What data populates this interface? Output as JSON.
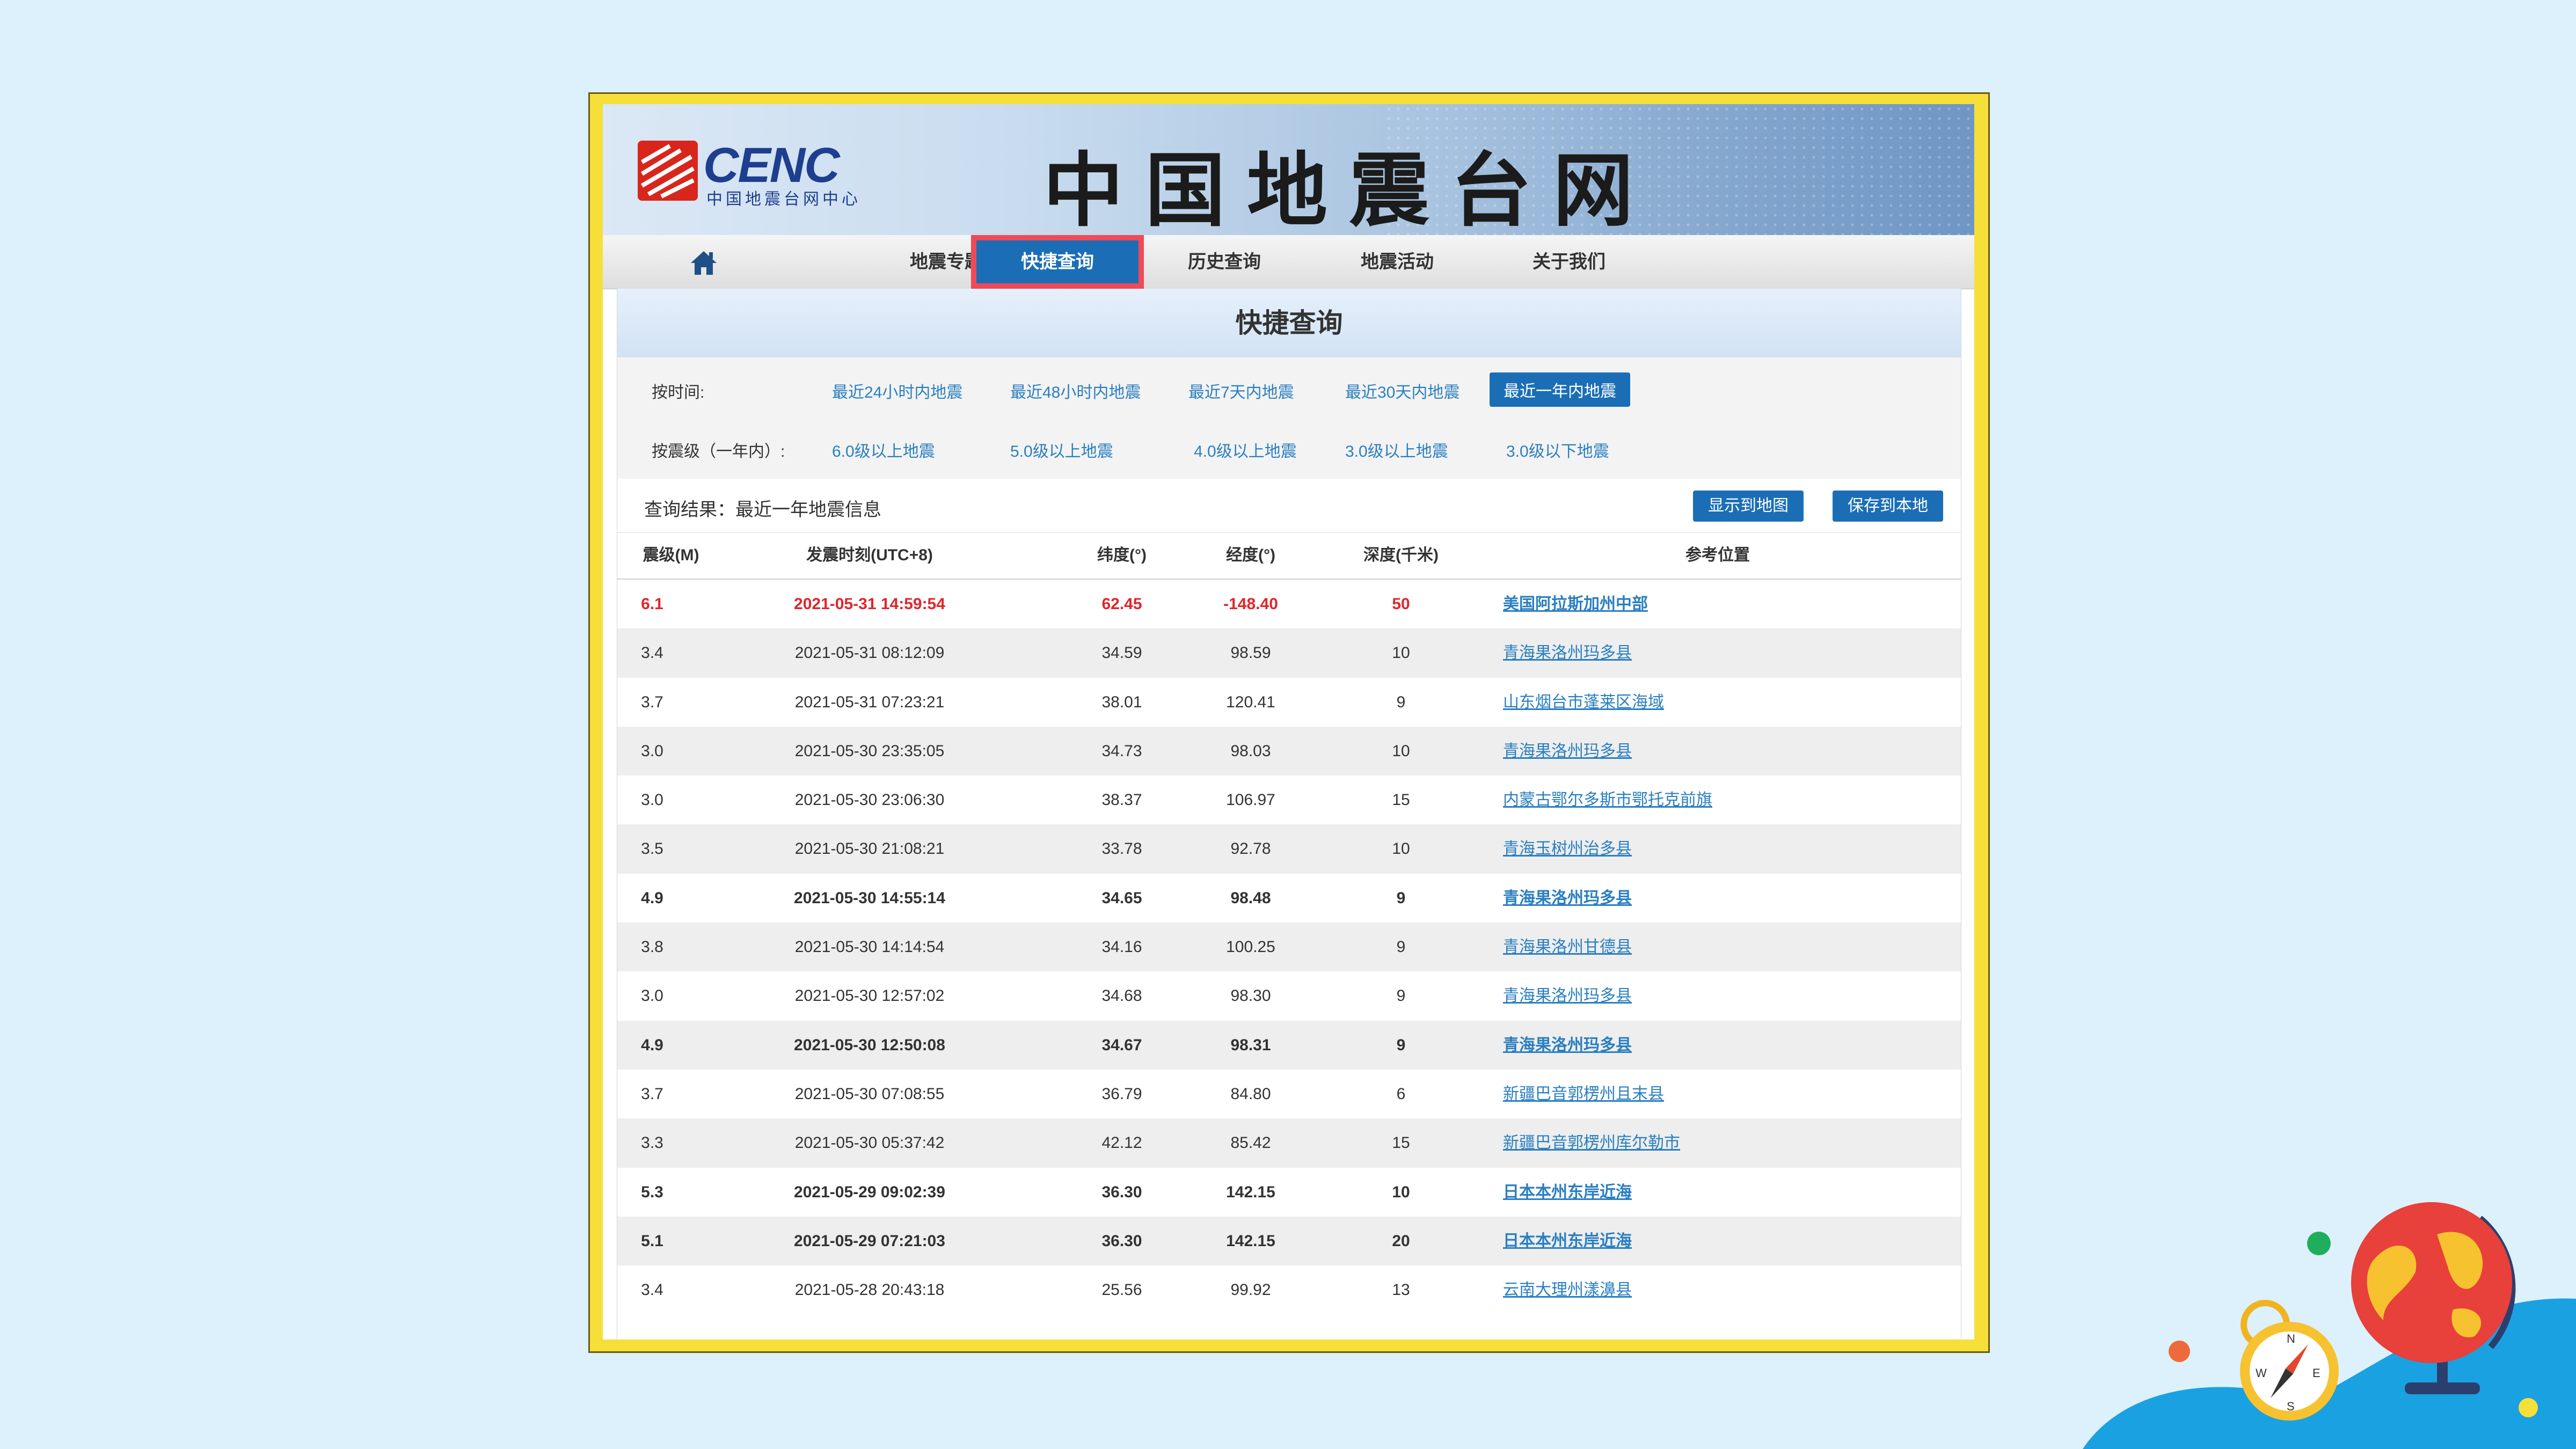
{
  "header": {
    "logo_text": "CENC",
    "logo_subtitle": "中国地震台网中心",
    "site_title": "中国地震台网"
  },
  "nav": {
    "items": [
      "地震专题",
      "快捷查询",
      "历史查询",
      "地震活动",
      "关于我们"
    ],
    "active": "快捷查询",
    "highlight_color": "#ee4a58"
  },
  "panel": {
    "title": "快捷查询",
    "time_filter": {
      "label": "按时间:",
      "options": [
        "最近24小时内地震",
        "最近48小时内地震",
        "最近7天内地震",
        "最近30天内地震",
        "最近一年内地震"
      ],
      "selected": "最近一年内地震"
    },
    "mag_filter": {
      "label": "按震级（一年内）:",
      "options": [
        "6.0级以上地震",
        "5.0级以上地震",
        "4.0级以上地震",
        "3.0级以上地震",
        "3.0级以下地震"
      ]
    },
    "result_text": "查询结果：最近一年地震信息",
    "buttons": {
      "show_map": "显示到地图",
      "save_local": "保存到本地"
    }
  },
  "table": {
    "headers": [
      "震级(M)",
      "发震时刻(UTC+8)",
      "纬度(°)",
      "经度(°)",
      "深度(千米)",
      "参考位置"
    ],
    "rows": [
      {
        "mag": "6.1",
        "time": "2021-05-31 14:59:54",
        "lat": "62.45",
        "lon": "-148.40",
        "depth": "50",
        "loc": "美国阿拉斯加州中部",
        "style": "red"
      },
      {
        "mag": "3.4",
        "time": "2021-05-31 08:12:09",
        "lat": "34.59",
        "lon": "98.59",
        "depth": "10",
        "loc": "青海果洛州玛多县",
        "style": "normal"
      },
      {
        "mag": "3.7",
        "time": "2021-05-31 07:23:21",
        "lat": "38.01",
        "lon": "120.41",
        "depth": "9",
        "loc": "山东烟台市蓬莱区海域",
        "style": "normal"
      },
      {
        "mag": "3.0",
        "time": "2021-05-30 23:35:05",
        "lat": "34.73",
        "lon": "98.03",
        "depth": "10",
        "loc": "青海果洛州玛多县",
        "style": "normal"
      },
      {
        "mag": "3.0",
        "time": "2021-05-30 23:06:30",
        "lat": "38.37",
        "lon": "106.97",
        "depth": "15",
        "loc": "内蒙古鄂尔多斯市鄂托克前旗",
        "style": "normal"
      },
      {
        "mag": "3.5",
        "time": "2021-05-30 21:08:21",
        "lat": "33.78",
        "lon": "92.78",
        "depth": "10",
        "loc": "青海玉树州治多县",
        "style": "normal"
      },
      {
        "mag": "4.9",
        "time": "2021-05-30 14:55:14",
        "lat": "34.65",
        "lon": "98.48",
        "depth": "9",
        "loc": "青海果洛州玛多县",
        "style": "bold"
      },
      {
        "mag": "3.8",
        "time": "2021-05-30 14:14:54",
        "lat": "34.16",
        "lon": "100.25",
        "depth": "9",
        "loc": "青海果洛州甘德县",
        "style": "normal"
      },
      {
        "mag": "3.0",
        "time": "2021-05-30 12:57:02",
        "lat": "34.68",
        "lon": "98.30",
        "depth": "9",
        "loc": "青海果洛州玛多县",
        "style": "normal"
      },
      {
        "mag": "4.9",
        "time": "2021-05-30 12:50:08",
        "lat": "34.67",
        "lon": "98.31",
        "depth": "9",
        "loc": "青海果洛州玛多县",
        "style": "bold"
      },
      {
        "mag": "3.7",
        "time": "2021-05-30 07:08:55",
        "lat": "36.79",
        "lon": "84.80",
        "depth": "6",
        "loc": "新疆巴音郭楞州且末县",
        "style": "normal"
      },
      {
        "mag": "3.3",
        "time": "2021-05-30 05:37:42",
        "lat": "42.12",
        "lon": "85.42",
        "depth": "15",
        "loc": "新疆巴音郭楞州库尔勒市",
        "style": "normal"
      },
      {
        "mag": "5.3",
        "time": "2021-05-29 09:02:39",
        "lat": "36.30",
        "lon": "142.15",
        "depth": "10",
        "loc": "日本本州东岸近海",
        "style": "bold"
      },
      {
        "mag": "5.1",
        "time": "2021-05-29 07:21:03",
        "lat": "36.30",
        "lon": "142.15",
        "depth": "20",
        "loc": "日本本州东岸近海",
        "style": "bold"
      },
      {
        "mag": "3.4",
        "time": "2021-05-28 20:43:18",
        "lat": "25.56",
        "lon": "99.92",
        "depth": "13",
        "loc": "云南大理州漾濞县",
        "style": "normal"
      }
    ]
  },
  "decor": {
    "compass_letters": [
      "N",
      "E",
      "S",
      "W"
    ]
  }
}
